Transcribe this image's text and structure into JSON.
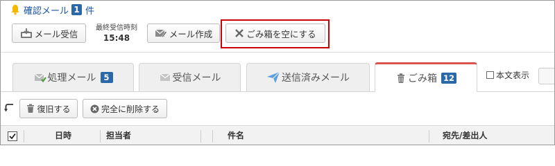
{
  "notification": {
    "text": "確認メール",
    "count": "1",
    "unit": "件"
  },
  "toolbar": {
    "receive_label": "メール受信",
    "last_received_label": "最終受信時刻",
    "last_received_time": "15:48",
    "compose_label": "メール作成",
    "empty_trash_label": "ごみ箱を空にする"
  },
  "tabs": [
    {
      "label": "処理メール",
      "badge": "5",
      "icon": "envelope-check-icon",
      "active": false
    },
    {
      "label": "受信メール",
      "badge": "",
      "icon": "envelope-icon",
      "active": false
    },
    {
      "label": "送信済みメール",
      "badge": "",
      "icon": "send-icon",
      "active": false
    },
    {
      "label": "ごみ箱",
      "badge": "12",
      "icon": "trash-icon",
      "active": true
    }
  ],
  "body_toggle_label": "本文表示",
  "actions": {
    "restore_label": "復旧する",
    "delete_label": "完全に削除する"
  },
  "table": {
    "columns": [
      "日時",
      "担当者",
      "件名",
      "宛先/差出人"
    ]
  },
  "colors": {
    "accent": "#2b68a8",
    "active_tab": "#d9534f",
    "highlight": "#cc0000"
  }
}
